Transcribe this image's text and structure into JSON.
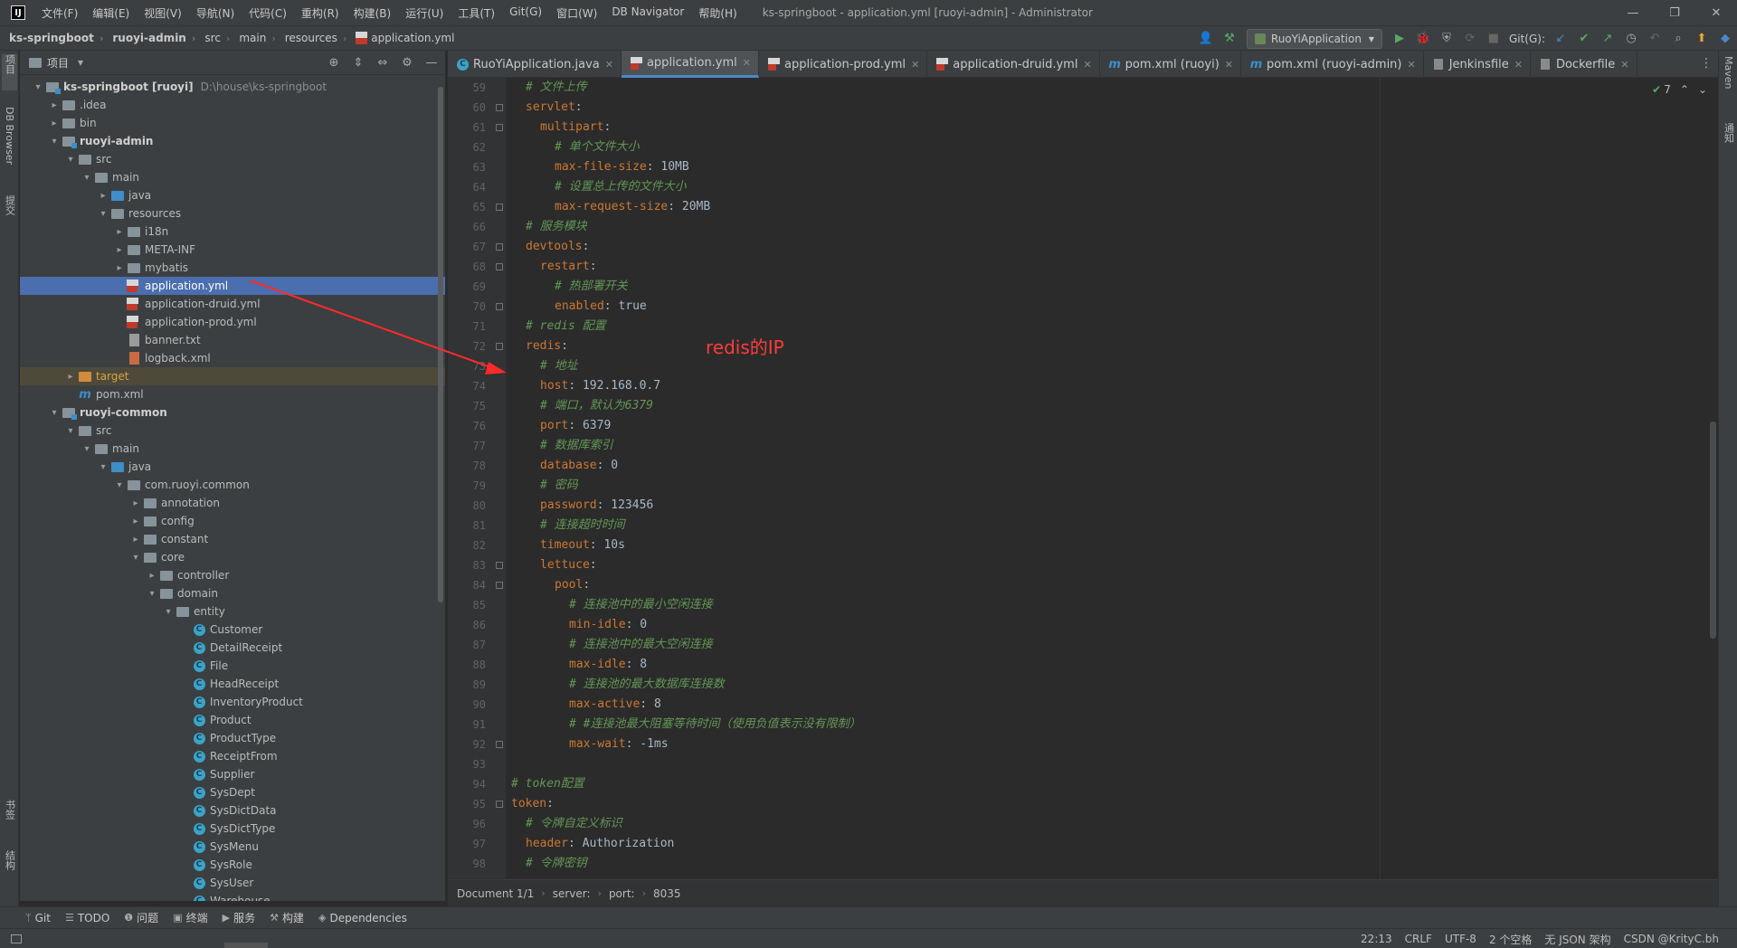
{
  "menubar": {
    "logo": "IJ",
    "items": [
      "文件(F)",
      "编辑(E)",
      "视图(V)",
      "导航(N)",
      "代码(C)",
      "重构(R)",
      "构建(B)",
      "运行(U)",
      "工具(T)",
      "Git(G)",
      "窗口(W)",
      "DB Navigator",
      "帮助(H)"
    ],
    "window_title": "ks-springboot - application.yml [ruoyi-admin] - Administrator",
    "controls": [
      "—",
      "❐",
      "✕"
    ]
  },
  "navbar": {
    "crumbs": [
      "ks-springboot",
      "ruoyi-admin",
      "src",
      "main",
      "resources",
      "application.yml"
    ],
    "run_config": "RuoYiApplication",
    "git_label": "Git(G):"
  },
  "left_strip": {
    "top_labels": [
      "项目",
      "DB Browser",
      "提交"
    ],
    "bottom_labels": [
      "书签",
      "结构"
    ]
  },
  "right_strip": {
    "labels": [
      "Maven",
      "通知"
    ]
  },
  "project": {
    "title": "项目",
    "tree": [
      {
        "indent": 0,
        "arrow": "▾",
        "icon": "module",
        "label": "ks-springboot [ruoyi]",
        "bold": true,
        "path": "D:\\house\\ks-springboot"
      },
      {
        "indent": 1,
        "arrow": "▸",
        "icon": "folder",
        "label": ".idea"
      },
      {
        "indent": 1,
        "arrow": "▸",
        "icon": "folder",
        "label": "bin"
      },
      {
        "indent": 1,
        "arrow": "▾",
        "icon": "module",
        "label": "ruoyi-admin",
        "bold": true
      },
      {
        "indent": 2,
        "arrow": "▾",
        "icon": "folder",
        "label": "src"
      },
      {
        "indent": 3,
        "arrow": "▾",
        "icon": "folder",
        "label": "main"
      },
      {
        "indent": 4,
        "arrow": "▸",
        "icon": "folder-blue",
        "label": "java"
      },
      {
        "indent": 4,
        "arrow": "▾",
        "icon": "folder",
        "label": "resources"
      },
      {
        "indent": 5,
        "arrow": "▸",
        "icon": "folder",
        "label": "i18n"
      },
      {
        "indent": 5,
        "arrow": "▸",
        "icon": "folder",
        "label": "META-INF"
      },
      {
        "indent": 5,
        "arrow": "▸",
        "icon": "folder",
        "label": "mybatis"
      },
      {
        "indent": 5,
        "arrow": "",
        "icon": "yml",
        "label": "application.yml",
        "selected": true
      },
      {
        "indent": 5,
        "arrow": "",
        "icon": "yml",
        "label": "application-druid.yml"
      },
      {
        "indent": 5,
        "arrow": "",
        "icon": "yml",
        "label": "application-prod.yml"
      },
      {
        "indent": 5,
        "arrow": "",
        "icon": "txt",
        "label": "banner.txt"
      },
      {
        "indent": 5,
        "arrow": "",
        "icon": "xml",
        "label": "logback.xml"
      },
      {
        "indent": 2,
        "arrow": "▸",
        "icon": "folder-orange",
        "label": "target",
        "excluded": true
      },
      {
        "indent": 2,
        "arrow": "",
        "icon": "maven",
        "label": "pom.xml"
      },
      {
        "indent": 1,
        "arrow": "▾",
        "icon": "module",
        "label": "ruoyi-common",
        "bold": true
      },
      {
        "indent": 2,
        "arrow": "▾",
        "icon": "folder",
        "label": "src"
      },
      {
        "indent": 3,
        "arrow": "▾",
        "icon": "folder",
        "label": "main"
      },
      {
        "indent": 4,
        "arrow": "▾",
        "icon": "folder-blue",
        "label": "java"
      },
      {
        "indent": 5,
        "arrow": "▾",
        "icon": "folder",
        "label": "com.ruoyi.common"
      },
      {
        "indent": 6,
        "arrow": "▸",
        "icon": "folder",
        "label": "annotation"
      },
      {
        "indent": 6,
        "arrow": "▸",
        "icon": "folder",
        "label": "config"
      },
      {
        "indent": 6,
        "arrow": "▸",
        "icon": "folder",
        "label": "constant"
      },
      {
        "indent": 6,
        "arrow": "▾",
        "icon": "folder",
        "label": "core"
      },
      {
        "indent": 7,
        "arrow": "▸",
        "icon": "folder",
        "label": "controller"
      },
      {
        "indent": 7,
        "arrow": "▾",
        "icon": "folder",
        "label": "domain"
      },
      {
        "indent": 8,
        "arrow": "▾",
        "icon": "folder",
        "label": "entity"
      },
      {
        "indent": 9,
        "arrow": "",
        "icon": "class",
        "label": "Customer"
      },
      {
        "indent": 9,
        "arrow": "",
        "icon": "class",
        "label": "DetailReceipt"
      },
      {
        "indent": 9,
        "arrow": "",
        "icon": "class",
        "label": "File"
      },
      {
        "indent": 9,
        "arrow": "",
        "icon": "class",
        "label": "HeadReceipt"
      },
      {
        "indent": 9,
        "arrow": "",
        "icon": "class",
        "label": "InventoryProduct"
      },
      {
        "indent": 9,
        "arrow": "",
        "icon": "class",
        "label": "Product"
      },
      {
        "indent": 9,
        "arrow": "",
        "icon": "class",
        "label": "ProductType"
      },
      {
        "indent": 9,
        "arrow": "",
        "icon": "class",
        "label": "ReceiptFrom"
      },
      {
        "indent": 9,
        "arrow": "",
        "icon": "class",
        "label": "Supplier"
      },
      {
        "indent": 9,
        "arrow": "",
        "icon": "class",
        "label": "SysDept"
      },
      {
        "indent": 9,
        "arrow": "",
        "icon": "class",
        "label": "SysDictData"
      },
      {
        "indent": 9,
        "arrow": "",
        "icon": "class",
        "label": "SysDictType"
      },
      {
        "indent": 9,
        "arrow": "",
        "icon": "class",
        "label": "SysMenu"
      },
      {
        "indent": 9,
        "arrow": "",
        "icon": "class",
        "label": "SysRole"
      },
      {
        "indent": 9,
        "arrow": "",
        "icon": "class",
        "label": "SysUser"
      },
      {
        "indent": 9,
        "arrow": "",
        "icon": "class",
        "label": "Warehouse"
      }
    ]
  },
  "editor": {
    "tabs": [
      {
        "label": "RuoYiApplication.java",
        "icon": "class"
      },
      {
        "label": "application.yml",
        "icon": "yml",
        "active": true
      },
      {
        "label": "application-prod.yml",
        "icon": "yml"
      },
      {
        "label": "application-druid.yml",
        "icon": "yml"
      },
      {
        "label": "pom.xml (ruoyi)",
        "icon": "maven"
      },
      {
        "label": "pom.xml (ruoyi-admin)",
        "icon": "maven"
      },
      {
        "label": "Jenkinsfile",
        "icon": "file"
      },
      {
        "label": "Dockerfile",
        "icon": "file"
      }
    ],
    "inspection_count": "7",
    "lines": [
      {
        "n": "59",
        "indent": 1,
        "comment": "# 文件上传"
      },
      {
        "n": "60",
        "indent": 1,
        "key": "servlet",
        "fold": true
      },
      {
        "n": "61",
        "indent": 2,
        "key": "multipart",
        "fold": true
      },
      {
        "n": "62",
        "indent": 3,
        "comment": "# 单个文件大小"
      },
      {
        "n": "63",
        "indent": 3,
        "key": "max-file-size",
        "value": "10MB"
      },
      {
        "n": "64",
        "indent": 3,
        "comment": "# 设置总上传的文件大小"
      },
      {
        "n": "65",
        "indent": 3,
        "key": "max-request-size",
        "value": "20MB",
        "fold": true
      },
      {
        "n": "66",
        "indent": 1,
        "comment": "# 服务模块"
      },
      {
        "n": "67",
        "indent": 1,
        "key": "devtools",
        "fold": true
      },
      {
        "n": "68",
        "indent": 2,
        "key": "restart",
        "fold": true
      },
      {
        "n": "69",
        "indent": 3,
        "comment": "# 热部署开关"
      },
      {
        "n": "70",
        "indent": 3,
        "key": "enabled",
        "value": "true",
        "fold": true
      },
      {
        "n": "71",
        "indent": 1,
        "comment": "# redis 配置"
      },
      {
        "n": "72",
        "indent": 1,
        "key": "redis",
        "fold": true
      },
      {
        "n": "73",
        "indent": 2,
        "comment": "# 地址"
      },
      {
        "n": "74",
        "indent": 2,
        "key": "host",
        "value": "192.168.0.7"
      },
      {
        "n": "75",
        "indent": 2,
        "comment": "# 端口，默认为6379"
      },
      {
        "n": "76",
        "indent": 2,
        "key": "port",
        "value": "6379"
      },
      {
        "n": "77",
        "indent": 2,
        "comment": "# 数据库索引"
      },
      {
        "n": "78",
        "indent": 2,
        "key": "database",
        "value": "0"
      },
      {
        "n": "79",
        "indent": 2,
        "comment": "# 密码"
      },
      {
        "n": "80",
        "indent": 2,
        "key": "password",
        "value": "123456"
      },
      {
        "n": "81",
        "indent": 2,
        "comment": "# 连接超时时间"
      },
      {
        "n": "82",
        "indent": 2,
        "key": "timeout",
        "value": "10s"
      },
      {
        "n": "83",
        "indent": 2,
        "key": "lettuce",
        "fold": true
      },
      {
        "n": "84",
        "indent": 3,
        "key": "pool",
        "fold": true
      },
      {
        "n": "85",
        "indent": 4,
        "comment": "# 连接池中的最小空闲连接"
      },
      {
        "n": "86",
        "indent": 4,
        "key": "min-idle",
        "value": "0"
      },
      {
        "n": "87",
        "indent": 4,
        "comment": "# 连接池中的最大空闲连接"
      },
      {
        "n": "88",
        "indent": 4,
        "key": "max-idle",
        "value": "8"
      },
      {
        "n": "89",
        "indent": 4,
        "comment": "# 连接池的最大数据库连接数"
      },
      {
        "n": "90",
        "indent": 4,
        "key": "max-active",
        "value": "8"
      },
      {
        "n": "91",
        "indent": 4,
        "comment": "# #连接池最大阻塞等待时间（使用负值表示没有限制）"
      },
      {
        "n": "92",
        "indent": 4,
        "key": "max-wait",
        "value": "-1ms",
        "fold": true
      },
      {
        "n": "93",
        "indent": 0
      },
      {
        "n": "94",
        "indent": 0,
        "comment": "# token配置"
      },
      {
        "n": "95",
        "indent": 0,
        "key": "token",
        "fold": true
      },
      {
        "n": "96",
        "indent": 1,
        "comment": "# 令牌自定义标识"
      },
      {
        "n": "97",
        "indent": 1,
        "key": "header",
        "value": "Authorization"
      },
      {
        "n": "98",
        "indent": 1,
        "comment": "# 令牌密钥"
      }
    ],
    "breadcrumb": [
      "Document 1/1",
      "server:",
      "port:",
      "8035"
    ]
  },
  "annotation": {
    "text": "redis的IP",
    "color": "#ff3b3b"
  },
  "bottom_tools": [
    {
      "icon": "git-icon",
      "glyph": "ᛘ",
      "label": "Git"
    },
    {
      "icon": "todo-icon",
      "glyph": "☰",
      "label": "TODO"
    },
    {
      "icon": "problems-icon",
      "glyph": "❶",
      "label": "问题"
    },
    {
      "icon": "terminal-icon",
      "glyph": "▣",
      "label": "终端"
    },
    {
      "icon": "services-icon",
      "glyph": "▶",
      "label": "服务"
    },
    {
      "icon": "build-icon",
      "glyph": "⚒",
      "label": "构建"
    },
    {
      "icon": "dependencies-icon",
      "glyph": "◈",
      "label": "Dependencies"
    }
  ],
  "statusbar": {
    "items": [
      "22:13",
      "CRLF",
      "UTF-8",
      "2 个空格",
      "无 JSON 架构",
      "CSDN @KrityC.bh"
    ]
  },
  "colors": {
    "accent": "#4a88c7",
    "selection": "#4b6eaf",
    "keyword": "#cc7832",
    "comment": "#629755"
  }
}
